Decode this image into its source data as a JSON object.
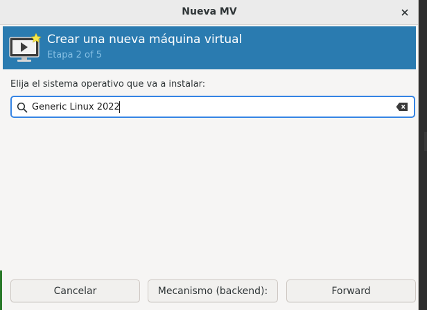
{
  "window": {
    "title": "Nueva MV"
  },
  "banner": {
    "heading": "Crear una nueva máquina virtual",
    "stage": "Etapa 2 of 5",
    "icon": "vm-monitor-icon",
    "color": "#2a7bb0"
  },
  "os_select": {
    "prompt": "Elija el sistema operativo que va a instalar:",
    "search_value": "Generic Linux 2022"
  },
  "buttons": {
    "cancel": "Cancelar",
    "backend": "Mecanismo (backend):",
    "forward": "Forward"
  },
  "colors": {
    "accent": "#3584e4",
    "window_bg": "#f6f5f4"
  }
}
